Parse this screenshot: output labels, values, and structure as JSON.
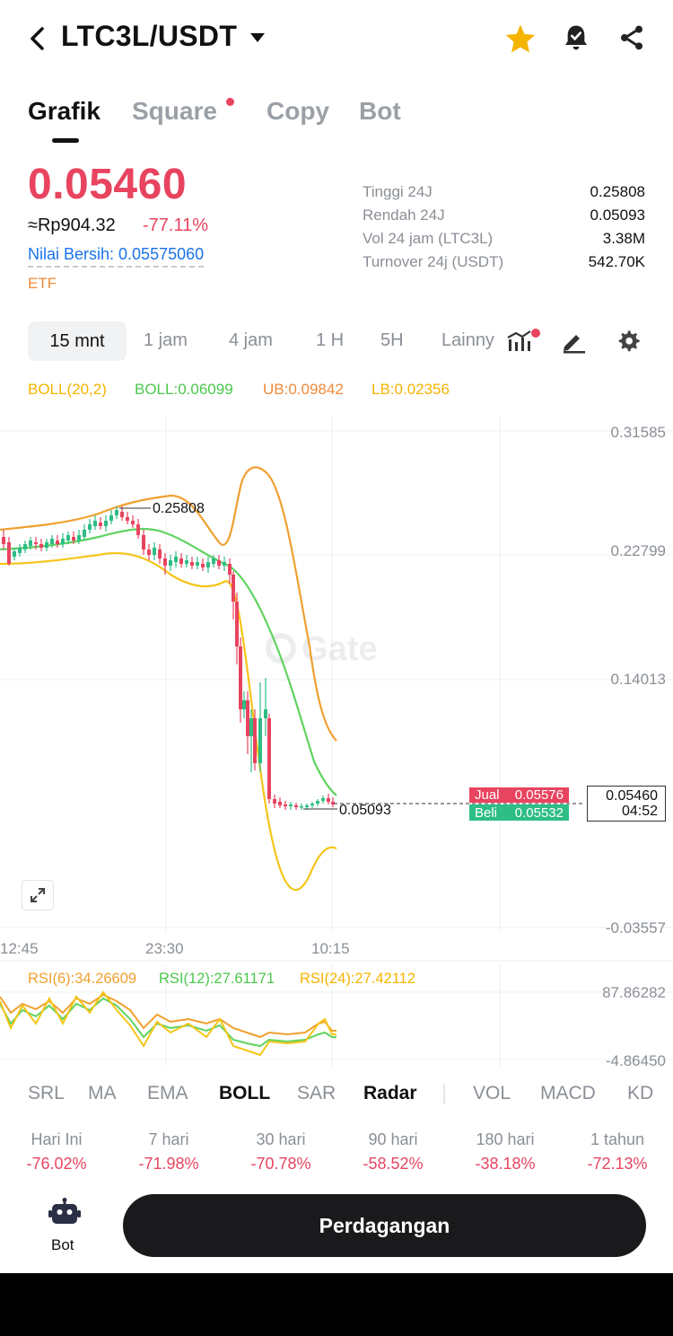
{
  "header": {
    "pair": "LTC3L/USDT"
  },
  "tabs": [
    {
      "label": "Grafik"
    },
    {
      "label": "Square"
    },
    {
      "label": "Copy"
    },
    {
      "label": "Bot"
    }
  ],
  "price": {
    "last": "0.05460",
    "idr": "≈Rp904.32",
    "change": "-77.11%",
    "nav": "Nilai Bersih: 0.05575060",
    "tag": "ETF"
  },
  "stats": [
    {
      "label": "Tinggi 24J",
      "value": "0.25808"
    },
    {
      "label": "Rendah 24J",
      "value": "0.05093"
    },
    {
      "label": "Vol 24 jam (LTC3L)",
      "value": "3.38M"
    },
    {
      "label": "Turnover 24j (USDT)",
      "value": "542.70K"
    }
  ],
  "timeframes": [
    "15 mnt",
    "1 jam",
    "4 jam",
    "1 H",
    "5H",
    "Lainny"
  ],
  "boll_legend": {
    "name": "BOLL(20,2)",
    "mid": "BOLL:0.06099",
    "ub": "UB:0.09842",
    "lb": "LB:0.02356"
  },
  "chart": {
    "y_ticks": [
      "0.31585",
      "0.22799",
      "0.14013",
      "-0.03557"
    ],
    "x_ticks": [
      "12:45",
      "23:30",
      "10:15"
    ],
    "high_marker": "0.25808",
    "low_marker": "0.05093",
    "sell_label": "Jual",
    "sell_price": "0.05576",
    "buy_label": "Beli",
    "buy_price": "0.05532",
    "current_price": "0.05460",
    "countdown": "04:52",
    "watermark": "Gate",
    "colors": {
      "up": "#2ebd85",
      "down": "#e8445f",
      "mid": "#5fd35f",
      "ub": "#f0a030",
      "lb": "#f5c518"
    }
  },
  "rsi": {
    "rsi6": "RSI(6):34.26609",
    "rsi12": "RSI(12):27.61171",
    "rsi24": "RSI(24):27.42112",
    "top": "87.86282",
    "bottom": "-4.86450"
  },
  "indicators": [
    "SRL",
    "MA",
    "EMA",
    "BOLL",
    "SAR",
    "Radar",
    "VOL",
    "MACD",
    "KD"
  ],
  "performance": [
    {
      "label": "Hari Ini",
      "value": "-76.02%"
    },
    {
      "label": "7 hari",
      "value": "-71.98%"
    },
    {
      "label": "30 hari",
      "value": "-70.78%"
    },
    {
      "label": "90 hari",
      "value": "-58.52%"
    },
    {
      "label": "180 hari",
      "value": "-38.18%"
    },
    {
      "label": "1 tahun",
      "value": "-72.13%"
    }
  ],
  "footer": {
    "bot_label": "Bot",
    "trade_label": "Perdagangan"
  }
}
